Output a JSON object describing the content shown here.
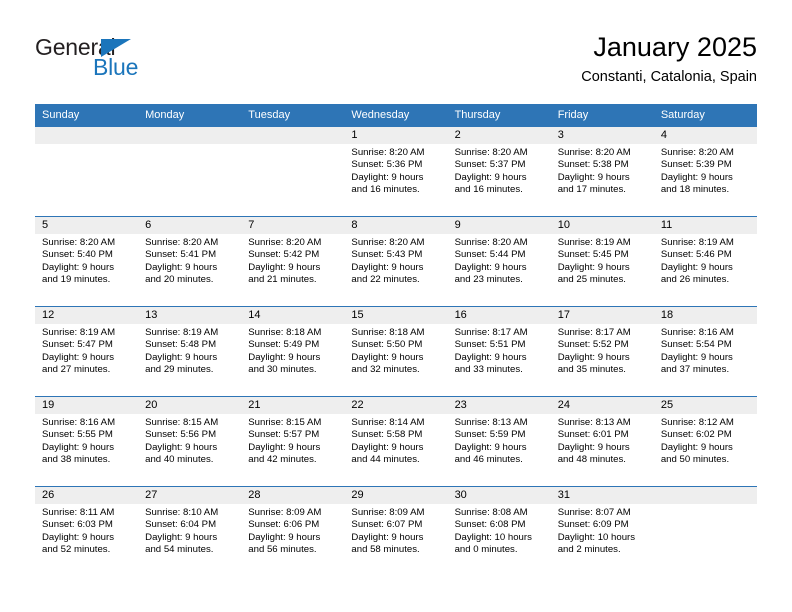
{
  "brand": {
    "name_top": "General",
    "name_bottom": "Blue",
    "accent_color": "#1b75bb"
  },
  "header": {
    "title": "January 2025",
    "subtitle": "Constanti, Catalonia, Spain"
  },
  "theme": {
    "header_blue": "#2e75b6",
    "daynum_band": "#eeeeee"
  },
  "weekday_headers": [
    "Sunday",
    "Monday",
    "Tuesday",
    "Wednesday",
    "Thursday",
    "Friday",
    "Saturday"
  ],
  "weeks": [
    [
      {
        "day": "",
        "lines": []
      },
      {
        "day": "",
        "lines": []
      },
      {
        "day": "",
        "lines": []
      },
      {
        "day": "1",
        "lines": [
          "Sunrise: 8:20 AM",
          "Sunset: 5:36 PM",
          "Daylight: 9 hours",
          "and 16 minutes."
        ]
      },
      {
        "day": "2",
        "lines": [
          "Sunrise: 8:20 AM",
          "Sunset: 5:37 PM",
          "Daylight: 9 hours",
          "and 16 minutes."
        ]
      },
      {
        "day": "3",
        "lines": [
          "Sunrise: 8:20 AM",
          "Sunset: 5:38 PM",
          "Daylight: 9 hours",
          "and 17 minutes."
        ]
      },
      {
        "day": "4",
        "lines": [
          "Sunrise: 8:20 AM",
          "Sunset: 5:39 PM",
          "Daylight: 9 hours",
          "and 18 minutes."
        ]
      }
    ],
    [
      {
        "day": "5",
        "lines": [
          "Sunrise: 8:20 AM",
          "Sunset: 5:40 PM",
          "Daylight: 9 hours",
          "and 19 minutes."
        ]
      },
      {
        "day": "6",
        "lines": [
          "Sunrise: 8:20 AM",
          "Sunset: 5:41 PM",
          "Daylight: 9 hours",
          "and 20 minutes."
        ]
      },
      {
        "day": "7",
        "lines": [
          "Sunrise: 8:20 AM",
          "Sunset: 5:42 PM",
          "Daylight: 9 hours",
          "and 21 minutes."
        ]
      },
      {
        "day": "8",
        "lines": [
          "Sunrise: 8:20 AM",
          "Sunset: 5:43 PM",
          "Daylight: 9 hours",
          "and 22 minutes."
        ]
      },
      {
        "day": "9",
        "lines": [
          "Sunrise: 8:20 AM",
          "Sunset: 5:44 PM",
          "Daylight: 9 hours",
          "and 23 minutes."
        ]
      },
      {
        "day": "10",
        "lines": [
          "Sunrise: 8:19 AM",
          "Sunset: 5:45 PM",
          "Daylight: 9 hours",
          "and 25 minutes."
        ]
      },
      {
        "day": "11",
        "lines": [
          "Sunrise: 8:19 AM",
          "Sunset: 5:46 PM",
          "Daylight: 9 hours",
          "and 26 minutes."
        ]
      }
    ],
    [
      {
        "day": "12",
        "lines": [
          "Sunrise: 8:19 AM",
          "Sunset: 5:47 PM",
          "Daylight: 9 hours",
          "and 27 minutes."
        ]
      },
      {
        "day": "13",
        "lines": [
          "Sunrise: 8:19 AM",
          "Sunset: 5:48 PM",
          "Daylight: 9 hours",
          "and 29 minutes."
        ]
      },
      {
        "day": "14",
        "lines": [
          "Sunrise: 8:18 AM",
          "Sunset: 5:49 PM",
          "Daylight: 9 hours",
          "and 30 minutes."
        ]
      },
      {
        "day": "15",
        "lines": [
          "Sunrise: 8:18 AM",
          "Sunset: 5:50 PM",
          "Daylight: 9 hours",
          "and 32 minutes."
        ]
      },
      {
        "day": "16",
        "lines": [
          "Sunrise: 8:17 AM",
          "Sunset: 5:51 PM",
          "Daylight: 9 hours",
          "and 33 minutes."
        ]
      },
      {
        "day": "17",
        "lines": [
          "Sunrise: 8:17 AM",
          "Sunset: 5:52 PM",
          "Daylight: 9 hours",
          "and 35 minutes."
        ]
      },
      {
        "day": "18",
        "lines": [
          "Sunrise: 8:16 AM",
          "Sunset: 5:54 PM",
          "Daylight: 9 hours",
          "and 37 minutes."
        ]
      }
    ],
    [
      {
        "day": "19",
        "lines": [
          "Sunrise: 8:16 AM",
          "Sunset: 5:55 PM",
          "Daylight: 9 hours",
          "and 38 minutes."
        ]
      },
      {
        "day": "20",
        "lines": [
          "Sunrise: 8:15 AM",
          "Sunset: 5:56 PM",
          "Daylight: 9 hours",
          "and 40 minutes."
        ]
      },
      {
        "day": "21",
        "lines": [
          "Sunrise: 8:15 AM",
          "Sunset: 5:57 PM",
          "Daylight: 9 hours",
          "and 42 minutes."
        ]
      },
      {
        "day": "22",
        "lines": [
          "Sunrise: 8:14 AM",
          "Sunset: 5:58 PM",
          "Daylight: 9 hours",
          "and 44 minutes."
        ]
      },
      {
        "day": "23",
        "lines": [
          "Sunrise: 8:13 AM",
          "Sunset: 5:59 PM",
          "Daylight: 9 hours",
          "and 46 minutes."
        ]
      },
      {
        "day": "24",
        "lines": [
          "Sunrise: 8:13 AM",
          "Sunset: 6:01 PM",
          "Daylight: 9 hours",
          "and 48 minutes."
        ]
      },
      {
        "day": "25",
        "lines": [
          "Sunrise: 8:12 AM",
          "Sunset: 6:02 PM",
          "Daylight: 9 hours",
          "and 50 minutes."
        ]
      }
    ],
    [
      {
        "day": "26",
        "lines": [
          "Sunrise: 8:11 AM",
          "Sunset: 6:03 PM",
          "Daylight: 9 hours",
          "and 52 minutes."
        ]
      },
      {
        "day": "27",
        "lines": [
          "Sunrise: 8:10 AM",
          "Sunset: 6:04 PM",
          "Daylight: 9 hours",
          "and 54 minutes."
        ]
      },
      {
        "day": "28",
        "lines": [
          "Sunrise: 8:09 AM",
          "Sunset: 6:06 PM",
          "Daylight: 9 hours",
          "and 56 minutes."
        ]
      },
      {
        "day": "29",
        "lines": [
          "Sunrise: 8:09 AM",
          "Sunset: 6:07 PM",
          "Daylight: 9 hours",
          "and 58 minutes."
        ]
      },
      {
        "day": "30",
        "lines": [
          "Sunrise: 8:08 AM",
          "Sunset: 6:08 PM",
          "Daylight: 10 hours",
          "and 0 minutes."
        ]
      },
      {
        "day": "31",
        "lines": [
          "Sunrise: 8:07 AM",
          "Sunset: 6:09 PM",
          "Daylight: 10 hours",
          "and 2 minutes."
        ]
      },
      {
        "day": "",
        "lines": []
      }
    ]
  ]
}
